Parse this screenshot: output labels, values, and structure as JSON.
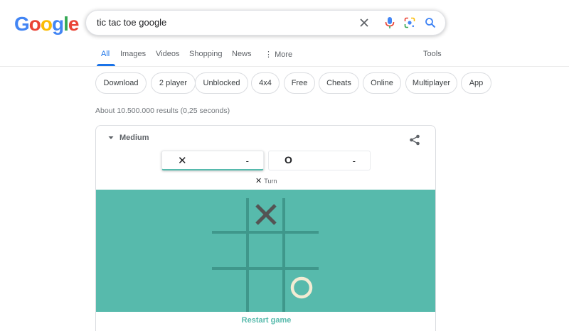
{
  "logo": {
    "letters": [
      "G",
      "o",
      "o",
      "g",
      "l",
      "e"
    ],
    "colors": [
      "#4285F4",
      "#EA4335",
      "#FBBC05",
      "#4285F4",
      "#34A853",
      "#EA4335"
    ]
  },
  "search": {
    "query": "tic tac toe google",
    "icons": [
      "clear-icon",
      "microphone-icon",
      "lens-icon",
      "search-icon"
    ]
  },
  "tabs": [
    "All",
    "Images",
    "Videos",
    "Shopping",
    "News",
    "More",
    "Tools"
  ],
  "chips": [
    "Download",
    "2 player",
    "Unblocked",
    "4x4",
    "Free",
    "Cheats",
    "Online",
    "Multiplayer",
    "App"
  ],
  "results_stats": "About 10.500.000 results (0,25 seconds)",
  "game": {
    "difficulty": "Medium",
    "players": [
      {
        "mark": "✕",
        "score": "-"
      },
      {
        "mark": "O",
        "score": "-"
      }
    ],
    "turn_mark": "✕",
    "turn_label": "Turn",
    "board": [
      [
        "",
        "X",
        ""
      ],
      [
        "",
        "",
        ""
      ],
      [
        "",
        "",
        "O"
      ]
    ],
    "restart_label": "Restart game",
    "colors": {
      "board": "#57baac",
      "grid": "#3f978b",
      "x": "#545454",
      "o": "#f2ebd3"
    }
  }
}
